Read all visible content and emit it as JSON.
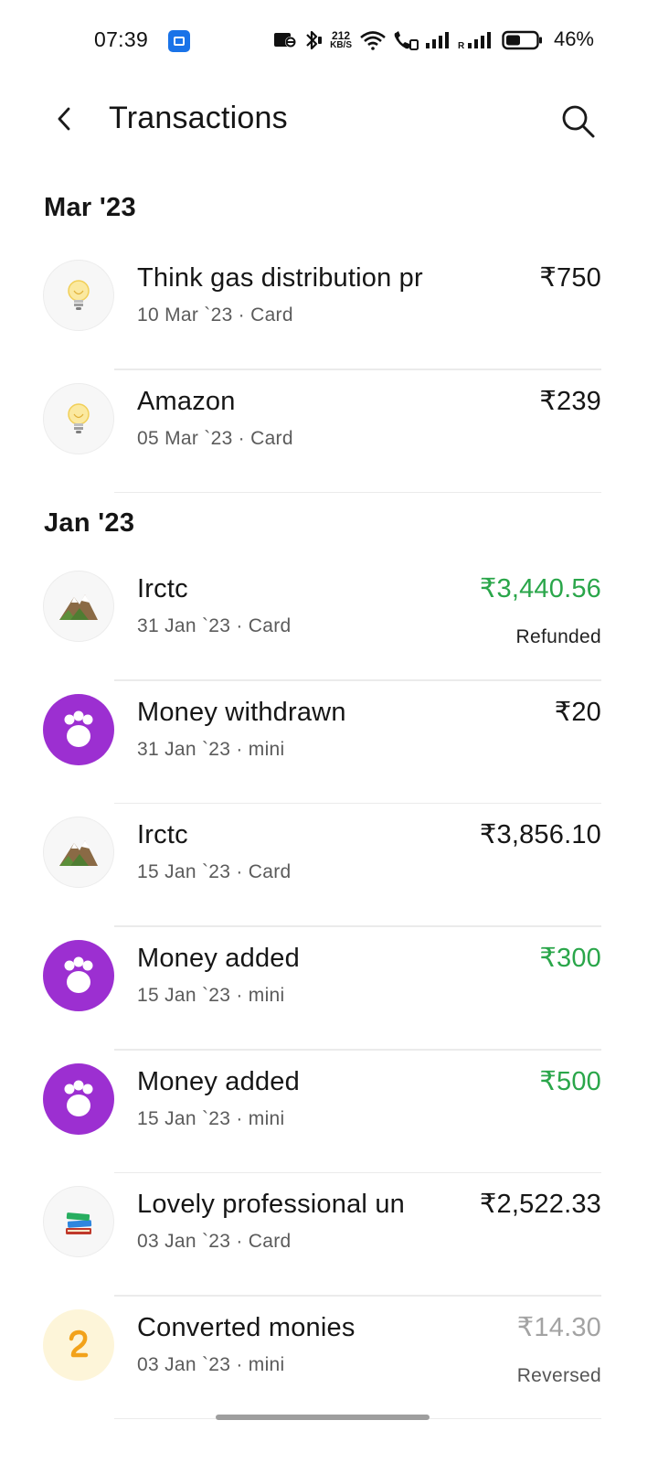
{
  "status_bar": {
    "time": "07:39",
    "speed_value": "212",
    "speed_unit": "KB/S",
    "battery": "46%",
    "icons": [
      "app-notification-icon",
      "nfc-icon",
      "bluetooth-icon",
      "wifi-icon",
      "volte-call-icon",
      "signal-icon",
      "roaming-signal-icon",
      "battery-icon"
    ]
  },
  "header": {
    "title": "Transactions",
    "back_icon": "back-arrow-icon",
    "search_icon": "search-icon"
  },
  "sections": [
    {
      "label": "Mar '23",
      "transactions": [
        {
          "name": "Think gas distribution pr",
          "meta": "10 Mar `23 · Card",
          "amount": "₹750",
          "status": "",
          "amount_color": "default",
          "icon": "lightbulb-icon"
        },
        {
          "name": "Amazon",
          "meta": "05 Mar `23 · Card",
          "amount": "₹239",
          "status": "",
          "amount_color": "default",
          "icon": "lightbulb-icon"
        }
      ]
    },
    {
      "label": "Jan '23",
      "transactions": [
        {
          "name": "Irctc",
          "meta": "31 Jan `23 · Card",
          "amount": "₹3,440.56",
          "status": "Refunded",
          "amount_color": "green",
          "icon": "mountain-icon"
        },
        {
          "name": "Money withdrawn",
          "meta": "31 Jan `23 · mini",
          "amount": "₹20",
          "status": "",
          "amount_color": "default",
          "icon": "paw-icon"
        },
        {
          "name": "Irctc",
          "meta": "15 Jan `23 · Card",
          "amount": "₹3,856.10",
          "status": "",
          "amount_color": "default",
          "icon": "mountain-icon"
        },
        {
          "name": "Money added",
          "meta": "15 Jan `23 · mini",
          "amount": "₹300",
          "status": "",
          "amount_color": "green",
          "icon": "paw-icon"
        },
        {
          "name": "Money added",
          "meta": "15 Jan `23 · mini",
          "amount": "₹500",
          "status": "",
          "amount_color": "green",
          "icon": "paw-icon"
        },
        {
          "name": "Lovely professional un",
          "meta": "03 Jan `23 · Card",
          "amount": "₹2,522.33",
          "status": "",
          "amount_color": "default",
          "icon": "books-icon"
        },
        {
          "name": "Converted monies",
          "meta": "03 Jan `23 · mini",
          "amount": "₹14.30",
          "status": "Reversed",
          "amount_color": "grey",
          "icon": "coin-icon"
        }
      ]
    }
  ],
  "colors": {
    "credit_green": "#2aa64a",
    "reversed_grey": "#a3a3a3",
    "mini_purple": "#9c2fd1",
    "coin_orange": "#f2a21a"
  }
}
